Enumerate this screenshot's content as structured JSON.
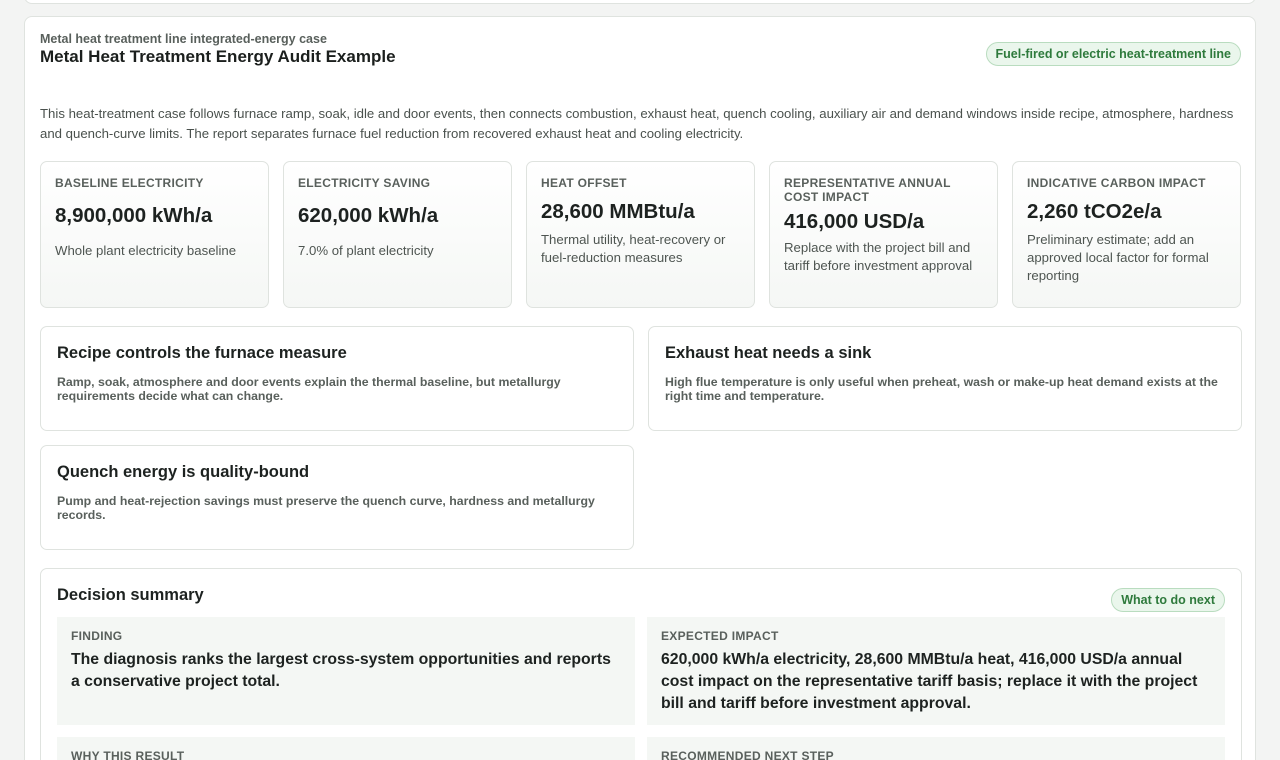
{
  "header": {
    "eyebrow": "Metal heat treatment line integrated-energy case",
    "title": "Metal Heat Treatment Energy Audit Example",
    "badge": "Fuel-fired or electric heat-treatment line"
  },
  "intro": "This heat-treatment case follows furnace ramp, soak, idle and door events, then connects combustion, exhaust heat, quench cooling, auxiliary air and demand windows inside recipe, atmosphere, hardness and quench-curve limits. The report separates furnace fuel reduction from recovered exhaust heat and cooling electricity.",
  "metrics": [
    {
      "label": "Baseline electricity",
      "value": "8,900,000 kWh/a",
      "note": "Whole plant electricity baseline"
    },
    {
      "label": "Electricity saving",
      "value": "620,000 kWh/a",
      "note": "7.0% of plant electricity"
    },
    {
      "label": "Heat offset",
      "value": "28,600 MMBtu/a",
      "note": "Thermal utility, heat-recovery or fuel-reduction measures"
    },
    {
      "label": "Representative annual cost impact",
      "value": "416,000 USD/a",
      "note": "Replace with the project bill and tariff before investment approval"
    },
    {
      "label": "Indicative carbon impact",
      "value": "2,260 tCO2e/a",
      "note": "Preliminary estimate; add an approved local factor for formal reporting"
    }
  ],
  "insights": [
    {
      "title": "Recipe controls the furnace measure",
      "body": "Ramp, soak, atmosphere and door events explain the thermal baseline, but metallurgy requirements decide what can change."
    },
    {
      "title": "Exhaust heat needs a sink",
      "body": "High flue temperature is only useful when preheat, wash or make-up heat demand exists at the right time and temperature."
    },
    {
      "title": "Quench energy is quality-bound",
      "body": "Pump and heat-rejection savings must preserve the quench curve, hardness and metallurgy records."
    }
  ],
  "decision": {
    "title": "Decision summary",
    "badge": "What to do next",
    "finding_label": "Finding",
    "finding_text": "The diagnosis ranks the largest cross-system opportunities and reports a conservative project total.",
    "impact_label": "Expected impact",
    "impact_text": "620,000 kWh/a electricity, 28,600 MMBtu/a heat, 416,000 USD/a annual cost impact on the representative tariff basis; replace it with the project bill and tariff before investment approval.",
    "why_label": "Why this result",
    "next_label": "Recommended next step"
  }
}
